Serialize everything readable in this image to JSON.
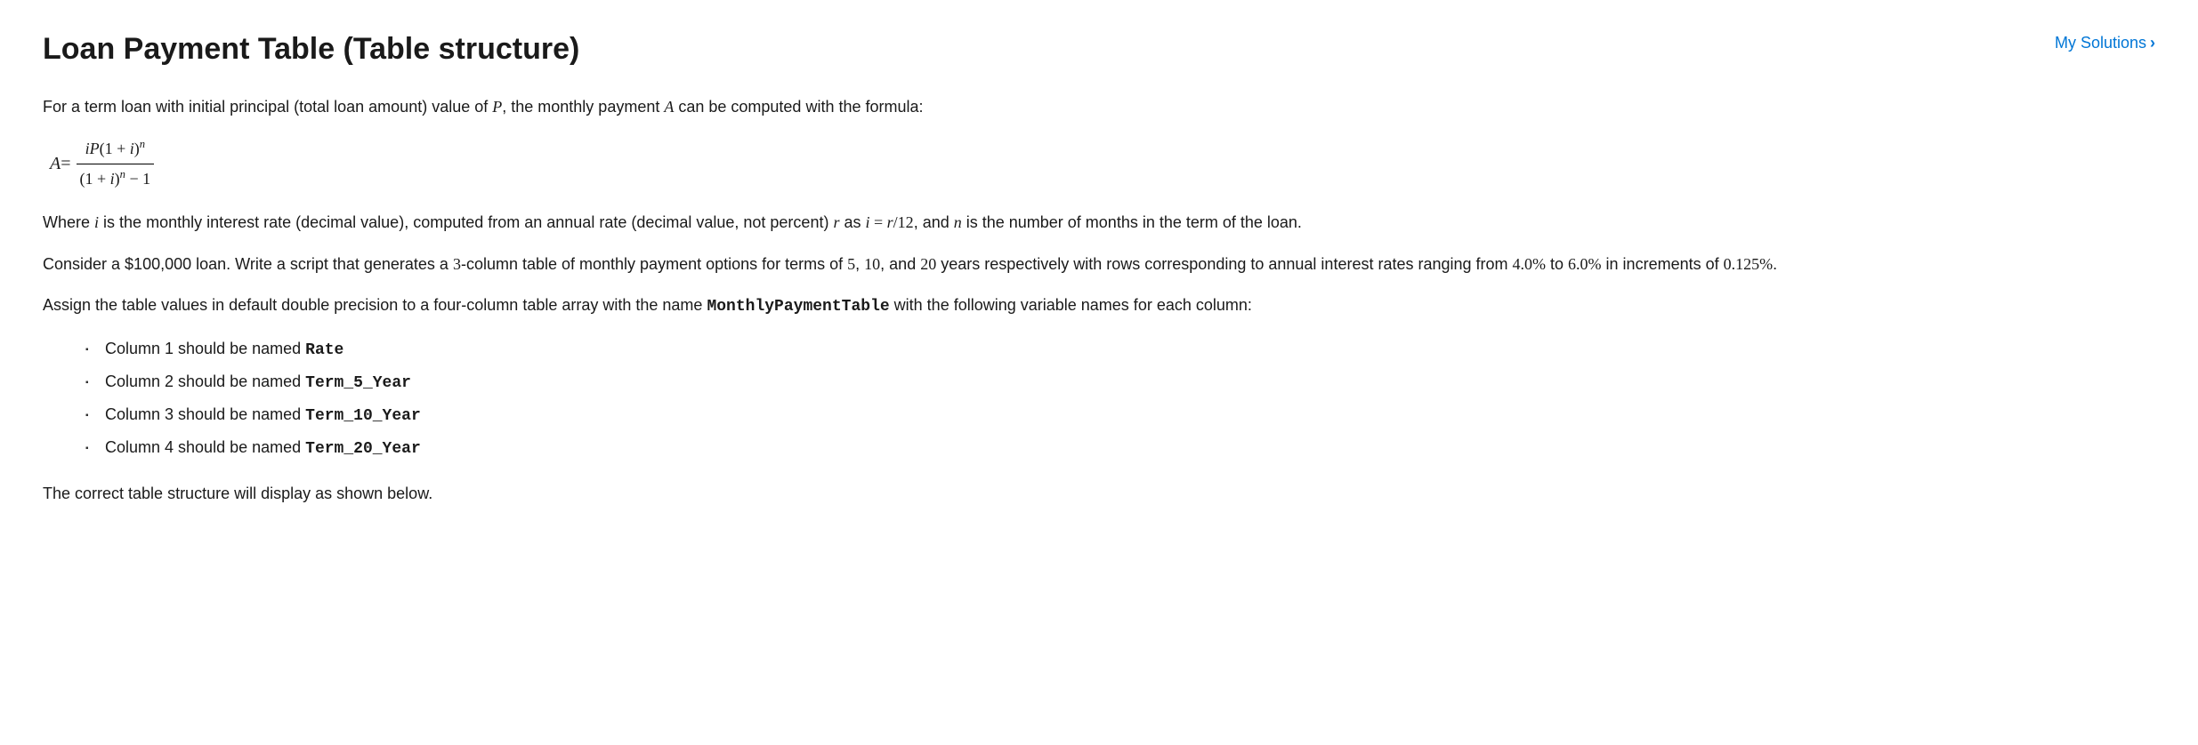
{
  "header": {
    "title": "Loan Payment Table (Table structure)",
    "link_label": "My Solutions"
  },
  "para1": {
    "t1": "For a term loan with initial principal (total loan amount) value of ",
    "v1": "P",
    "t2": ", the monthly payment ",
    "v2": "A",
    "t3": " can be computed with the formula:"
  },
  "formula": {
    "lhs": "A",
    "eq": " = ",
    "num_a": "iP",
    "num_b": "(1 + ",
    "num_c": "i",
    "num_d": ")",
    "num_exp": "n",
    "den_a": "(1 + ",
    "den_b": "i",
    "den_c": ")",
    "den_exp": "n",
    "den_d": " − 1"
  },
  "para2": {
    "t1": "Where ",
    "v1": "i",
    "t2": " is the monthly interest rate (decimal value), computed from an annual rate (decimal value, not percent) ",
    "v2": "r",
    "t3": " as ",
    "eq1": "i",
    "eq2": " = ",
    "eq3": "r",
    "eq4": "/12",
    "t4": ", and ",
    "v3": "n",
    "t5": " is the number of months in the term of the loan."
  },
  "para3": {
    "t1": "Consider a $100,000 loan. Write a script that generates a ",
    "n1": "3",
    "t2": "-column table of monthly payment options for terms of ",
    "n2": "5",
    "t3": ", ",
    "n3": "10",
    "t4": ", and ",
    "n4": "20",
    "t5": " years respectively with rows corresponding to annual interest rates ranging from ",
    "n5": "4.0%",
    "t6": " to ",
    "n6": "6.0%",
    "t7": " in increments of ",
    "n7": "0.125%",
    "t8": "."
  },
  "para4": {
    "t1": "Assign the table values in default double precision to a four-column table array with the name ",
    "code1": "MonthlyPaymentTable",
    "t2": " with the following variable names for each column:"
  },
  "columns": [
    {
      "pre": "Column 1 should be named ",
      "name": "Rate"
    },
    {
      "pre": "Column 2 should be named ",
      "name": "Term_5_Year"
    },
    {
      "pre": "Column 3 should be named ",
      "name": "Term_10_Year"
    },
    {
      "pre": "Column 4 should be named ",
      "name": "Term_20_Year"
    }
  ],
  "para5": "The correct table structure will display as shown below."
}
